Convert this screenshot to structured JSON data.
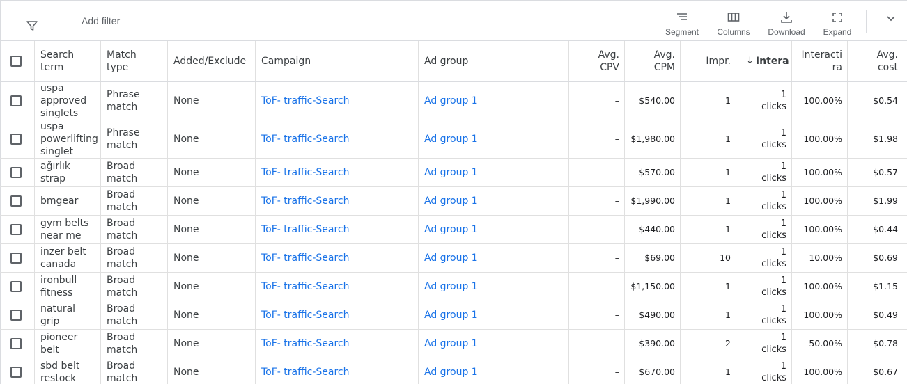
{
  "toolbar": {
    "add_filter": "Add filter",
    "segment": "Segment",
    "columns": "Columns",
    "download": "Download",
    "expand": "Expand"
  },
  "headers": {
    "search_term": [
      "Search",
      "term"
    ],
    "match_type": [
      "Match",
      "type"
    ],
    "added_excluded": "Added/Exclude",
    "campaign": "Campaign",
    "ad_group": "Ad group",
    "avg_cpv": [
      "Avg.",
      "CPV"
    ],
    "avg_cpm": [
      "Avg.",
      "CPM"
    ],
    "impr": "Impr.",
    "interactions": "Intera",
    "interaction_rate": [
      "Interacti",
      "ra"
    ],
    "avg_cost": [
      "Avg.",
      "cost"
    ]
  },
  "rows": [
    {
      "term": [
        "uspa",
        "approved",
        "singlets"
      ],
      "match": [
        "Phrase",
        "match"
      ],
      "added": "None",
      "campaign": "ToF- traffic-Search",
      "ad_group": "Ad group 1",
      "cpv": "–",
      "cpm": "$540.00",
      "impr": "1",
      "inter": [
        "1",
        "clicks"
      ],
      "rate": "100.00%",
      "cost": "$0.54"
    },
    {
      "term": [
        "uspa",
        "powerlifting",
        "singlet"
      ],
      "match": [
        "Phrase",
        "match"
      ],
      "added": "None",
      "campaign": "ToF- traffic-Search",
      "ad_group": "Ad group 1",
      "cpv": "–",
      "cpm": "$1,980.00",
      "impr": "1",
      "inter": [
        "1",
        "clicks"
      ],
      "rate": "100.00%",
      "cost": "$1.98"
    },
    {
      "term": [
        "ağırlık",
        "strap"
      ],
      "match": [
        "Broad",
        "match"
      ],
      "added": "None",
      "campaign": "ToF- traffic-Search",
      "ad_group": "Ad group 1",
      "cpv": "–",
      "cpm": "$570.00",
      "impr": "1",
      "inter": [
        "1",
        "clicks"
      ],
      "rate": "100.00%",
      "cost": "$0.57"
    },
    {
      "term": [
        "bmgear"
      ],
      "match": [
        "Broad",
        "match"
      ],
      "added": "None",
      "campaign": "ToF- traffic-Search",
      "ad_group": "Ad group 1",
      "cpv": "–",
      "cpm": "$1,990.00",
      "impr": "1",
      "inter": [
        "1",
        "clicks"
      ],
      "rate": "100.00%",
      "cost": "$1.99"
    },
    {
      "term": [
        "gym belts",
        "near me"
      ],
      "match": [
        "Broad",
        "match"
      ],
      "added": "None",
      "campaign": "ToF- traffic-Search",
      "ad_group": "Ad group 1",
      "cpv": "–",
      "cpm": "$440.00",
      "impr": "1",
      "inter": [
        "1",
        "clicks"
      ],
      "rate": "100.00%",
      "cost": "$0.44"
    },
    {
      "term": [
        "inzer belt",
        "canada"
      ],
      "match": [
        "Broad",
        "match"
      ],
      "added": "None",
      "campaign": "ToF- traffic-Search",
      "ad_group": "Ad group 1",
      "cpv": "–",
      "cpm": "$69.00",
      "impr": "10",
      "inter": [
        "1",
        "clicks"
      ],
      "rate": "10.00%",
      "cost": "$0.69"
    },
    {
      "term": [
        "ironbull",
        "fitness"
      ],
      "match": [
        "Broad",
        "match"
      ],
      "added": "None",
      "campaign": "ToF- traffic-Search",
      "ad_group": "Ad group 1",
      "cpv": "–",
      "cpm": "$1,150.00",
      "impr": "1",
      "inter": [
        "1",
        "clicks"
      ],
      "rate": "100.00%",
      "cost": "$1.15"
    },
    {
      "term": [
        "natural",
        "grip"
      ],
      "match": [
        "Broad",
        "match"
      ],
      "added": "None",
      "campaign": "ToF- traffic-Search",
      "ad_group": "Ad group 1",
      "cpv": "–",
      "cpm": "$490.00",
      "impr": "1",
      "inter": [
        "1",
        "clicks"
      ],
      "rate": "100.00%",
      "cost": "$0.49"
    },
    {
      "term": [
        "pioneer",
        "belt"
      ],
      "match": [
        "Broad",
        "match"
      ],
      "added": "None",
      "campaign": "ToF- traffic-Search",
      "ad_group": "Ad group 1",
      "cpv": "–",
      "cpm": "$390.00",
      "impr": "2",
      "inter": [
        "1",
        "clicks"
      ],
      "rate": "50.00%",
      "cost": "$0.78"
    },
    {
      "term": [
        "sbd belt",
        "restock"
      ],
      "match": [
        "Broad",
        "match"
      ],
      "added": "None",
      "campaign": "ToF- traffic-Search",
      "ad_group": "Ad group 1",
      "cpv": "–",
      "cpm": "$670.00",
      "impr": "1",
      "inter": [
        "1",
        "clicks"
      ],
      "rate": "100.00%",
      "cost": "$0.67"
    }
  ],
  "colors": {
    "link": "#1a73e8",
    "text": "#3c4043",
    "border": "#e0e0e0"
  }
}
